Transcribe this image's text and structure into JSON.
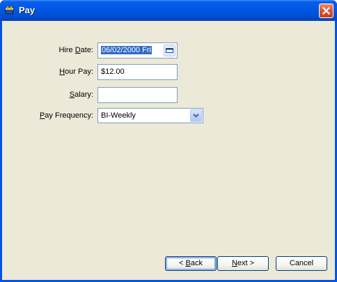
{
  "window": {
    "title": "Pay",
    "close_glyph": "×"
  },
  "form": {
    "hire_date": {
      "label_pre": "Hire ",
      "label_accel": "D",
      "label_post": "ate:",
      "value": "06/02/2000 Fri"
    },
    "hour_pay": {
      "label_pre": "",
      "label_accel": "H",
      "label_post": "our Pay:",
      "value": "$12.00"
    },
    "salary": {
      "label_pre": "",
      "label_accel": "S",
      "label_post": "alary:",
      "value": ""
    },
    "pay_frequency": {
      "label_pre": "",
      "label_accel": "P",
      "label_post": "ay Frequency:",
      "value": "BI-Weekly"
    }
  },
  "buttons": {
    "back": {
      "pre": "< ",
      "accel": "B",
      "post": "ack"
    },
    "next": {
      "pre": "",
      "accel": "N",
      "post": "ext >"
    },
    "cancel": {
      "label": "Cancel"
    }
  },
  "colors": {
    "title_bar": "#0058e6",
    "client_bg": "#ece9d8",
    "selection": "#316ac5",
    "close_button": "#e2562f"
  },
  "icons": {
    "app": "pay-app-icon",
    "close": "close-icon",
    "calendar": "calendar-icon",
    "dropdown": "chevron-down-icon"
  }
}
